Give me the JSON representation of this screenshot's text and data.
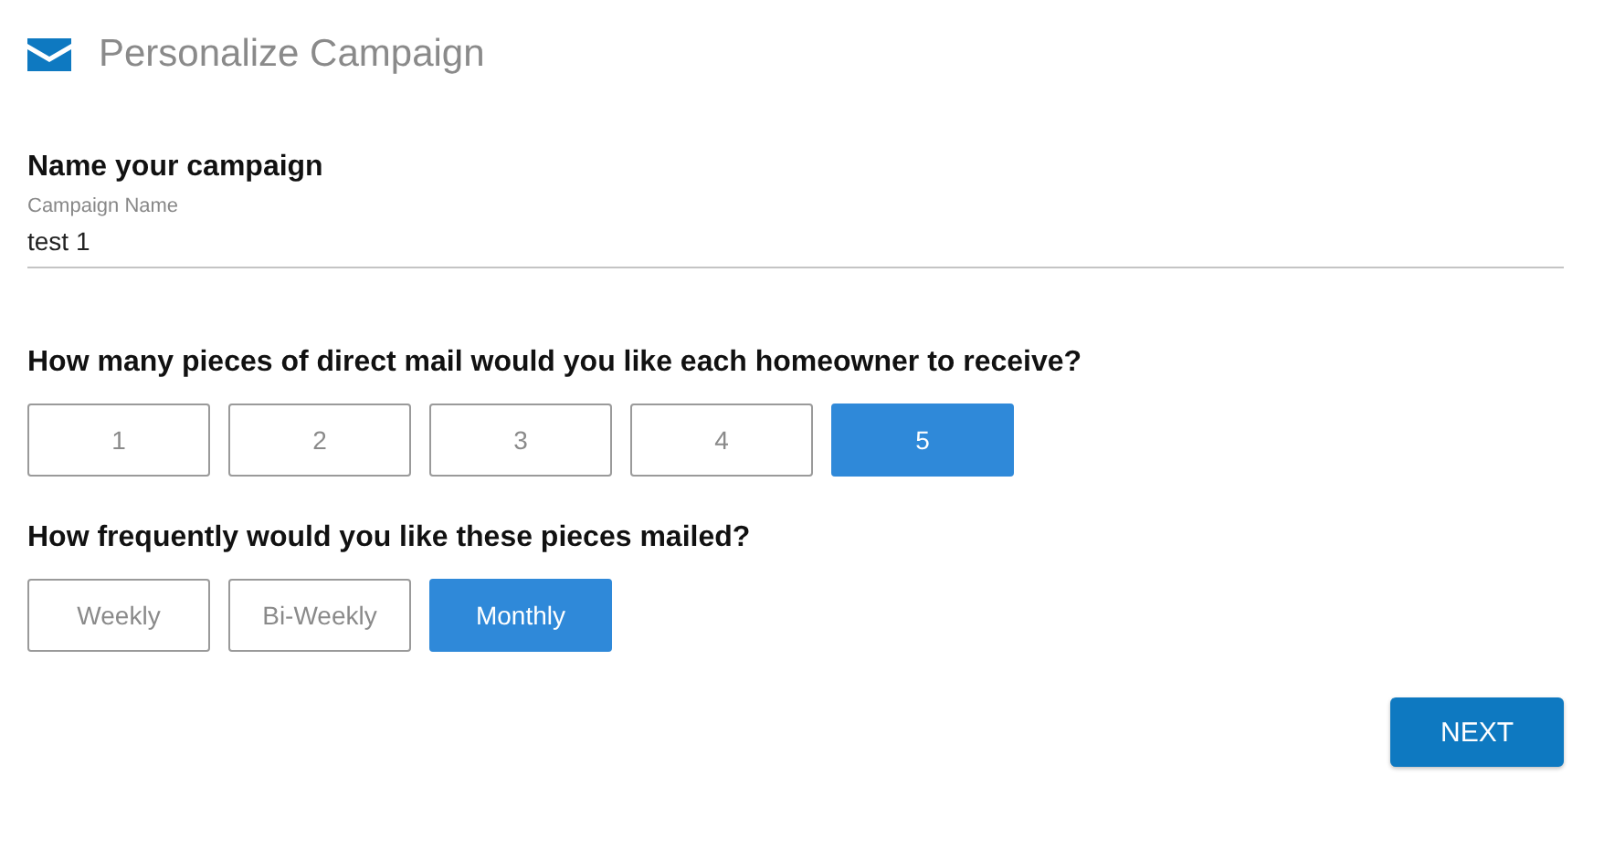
{
  "header": {
    "title": "Personalize Campaign"
  },
  "name_section": {
    "heading": "Name your campaign",
    "field_label": "Campaign Name",
    "value": "test 1"
  },
  "pieces_question": {
    "text": "How many pieces of direct mail would you like each homeowner to receive?",
    "options": [
      {
        "label": "1",
        "selected": false
      },
      {
        "label": "2",
        "selected": false
      },
      {
        "label": "3",
        "selected": false
      },
      {
        "label": "4",
        "selected": false
      },
      {
        "label": "5",
        "selected": true
      }
    ]
  },
  "frequency_question": {
    "text": "How frequently would you like these pieces mailed?",
    "options": [
      {
        "label": "Weekly",
        "selected": false
      },
      {
        "label": "Bi-Weekly",
        "selected": false
      },
      {
        "label": "Monthly",
        "selected": true
      }
    ]
  },
  "next_button": "NEXT"
}
